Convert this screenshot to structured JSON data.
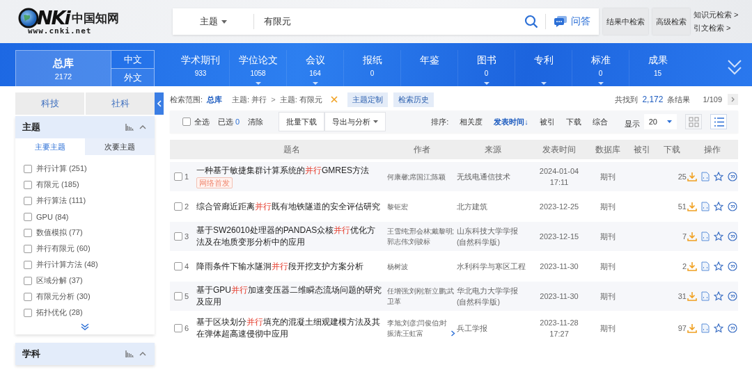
{
  "header": {
    "logo": {
      "letters": "NKi",
      "name": "中国知网",
      "url": "www.cnki.net"
    },
    "search_field": "主题",
    "query": "有限元",
    "qa_label": "问答",
    "buttons": [
      "结果中检索",
      "高级检索"
    ],
    "links": [
      "知识元检索 >",
      "引文检索 >"
    ]
  },
  "nav": {
    "library": {
      "label": "总库",
      "count": "2172",
      "selected": true
    },
    "languages": [
      {
        "label": "中文"
      },
      {
        "label": "外文"
      }
    ],
    "databases": [
      {
        "label": "学术期刊",
        "count": "933",
        "has_menu": false
      },
      {
        "label": "学位论文",
        "count": "1058",
        "has_menu": true
      },
      {
        "label": "会议",
        "count": "164",
        "has_menu": true
      },
      {
        "label": "报纸",
        "count": "0",
        "has_menu": false
      },
      {
        "label": "年鉴",
        "has_menu": false
      },
      {
        "label": "图书",
        "count": "0",
        "has_menu": true
      },
      {
        "label": "专利",
        "has_menu": true
      },
      {
        "label": "标准",
        "count": "0",
        "has_menu": true
      },
      {
        "label": "成果",
        "count": "15",
        "has_menu": false
      }
    ]
  },
  "sidebar": {
    "source_tabs": [
      {
        "label": "科技"
      },
      {
        "label": "社科"
      }
    ],
    "groups": [
      {
        "title": "主题",
        "subtabs": [
          {
            "label": "主要主题",
            "selected": true
          },
          {
            "label": "次要主题",
            "selected": false
          }
        ],
        "items": [
          {
            "label": "并行计算",
            "count": "(251)",
            "checked": false
          },
          {
            "label": "有限元",
            "count": "(185)",
            "checked": false
          },
          {
            "label": "并行算法",
            "count": "(111)",
            "checked": false
          },
          {
            "label": "GPU",
            "count": "(84)",
            "checked": false
          },
          {
            "label": "数值模拟",
            "count": "(77)",
            "checked": false
          },
          {
            "label": "并行有限元",
            "count": "(60)",
            "checked": false
          },
          {
            "label": "并行计算方法",
            "count": "(48)",
            "checked": false
          },
          {
            "label": "区域分解",
            "count": "(37)",
            "checked": false
          },
          {
            "label": "有限元分析",
            "count": "(30)",
            "checked": false
          },
          {
            "label": "拓扑优化",
            "count": "(28)",
            "checked": false
          }
        ]
      },
      {
        "title": "学科"
      }
    ]
  },
  "results": {
    "scope_label": "检索范围:",
    "scope": "总库",
    "crumbs": [
      "主题: 并行",
      "主题: 有限元"
    ],
    "crumb_separator": ">",
    "chips": [
      "主题定制",
      "检索历史"
    ],
    "found_label": "共找到",
    "total": "2,172",
    "total_suffix": "条结果",
    "page": "1/109",
    "select_all": {
      "label": "全选",
      "checked": false
    },
    "selected_label": "已选",
    "selected_count": "0",
    "clear_label": "清除",
    "buttons": [
      "批量下载"
    ],
    "export_label": "导出与分析",
    "sort_label": "排序:",
    "sorts": [
      {
        "label": "相关度",
        "selected": false
      },
      {
        "label": "发表时间↓",
        "selected": true
      },
      {
        "label": "被引",
        "selected": false
      },
      {
        "label": "下载",
        "selected": false
      },
      {
        "label": "综合",
        "selected": false
      }
    ],
    "page_size_label": "显示",
    "page_size": "20",
    "views": [
      {
        "kind": "grid",
        "selected": false
      },
      {
        "kind": "list",
        "selected": true
      }
    ],
    "columns": [
      "题名",
      "作者",
      "来源",
      "发表时间",
      "数据库",
      "被引",
      "下载",
      "操作"
    ],
    "rows": [
      {
        "number": "1",
        "checked": false,
        "title": [
          {
            "text": "一种基于敏捷集群计算系统的",
            "highlight": false
          },
          {
            "text": "并行",
            "highlight": true
          },
          {
            "text": "GMRES方法",
            "highlight": false
          }
        ],
        "badge": "网络首发",
        "authors": "何康馨;席国江;陈颖",
        "more_authors": false,
        "source": "无线电通信技术",
        "date": "2024-01-04",
        "time": "17:11",
        "database": "期刊",
        "downloads": "25"
      },
      {
        "number": "2",
        "checked": false,
        "title": [
          {
            "text": "综合管廊近距离",
            "highlight": false
          },
          {
            "text": "并行",
            "highlight": true
          },
          {
            "text": "既有地铁隧道的安全评估研究",
            "highlight": false
          }
        ],
        "authors": "黎钜宏",
        "more_authors": false,
        "source": "北方建筑",
        "date": "2023-12-25",
        "database": "期刊",
        "downloads": "51"
      },
      {
        "number": "3",
        "checked": false,
        "title": [
          {
            "text": "基于SW26010处理器的PANDAS众核",
            "highlight": false
          },
          {
            "text": "并行",
            "highlight": true
          },
          {
            "text": "优化方法及在地质变形分析中的应用",
            "highlight": false
          }
        ],
        "authors": "王雪纯;邢会林;戴黎明;郭志伟;刘骏标",
        "more_authors": false,
        "source": "山东科技大学学报(自然科学版)",
        "date": "2023-12-15",
        "database": "期刊",
        "downloads": "7"
      },
      {
        "number": "4",
        "checked": false,
        "title": [
          {
            "text": "降雨条件下输水隧洞",
            "highlight": false
          },
          {
            "text": "并行",
            "highlight": true
          },
          {
            "text": "段开挖支护方案分析",
            "highlight": false
          }
        ],
        "authors": "杨树波",
        "more_authors": false,
        "source": "水利科学与寒区工程",
        "date": "2023-11-30",
        "database": "期刊",
        "downloads": "2"
      },
      {
        "number": "5",
        "checked": false,
        "title": [
          {
            "text": "基于GPU",
            "highlight": false
          },
          {
            "text": "并行",
            "highlight": true
          },
          {
            "text": "加速变压器二维瞬态流场问题的研究及应用",
            "highlight": false
          }
        ],
        "authors": "任增强;刘刚;靳立鹏;武卫革",
        "more_authors": false,
        "source": "华北电力大学学报(自然科学版)",
        "date": "2023-11-30",
        "database": "期刊",
        "downloads": "31"
      },
      {
        "number": "6",
        "checked": false,
        "title": [
          {
            "text": "基于区块划分",
            "highlight": false
          },
          {
            "text": "并行",
            "highlight": true
          },
          {
            "text": "填充的混凝土细观建模方法及其在弹体超高速侵彻中应用",
            "highlight": false
          }
        ],
        "authors": "李旭;刘彦;闫俊伯;时振清;王虹富",
        "more_authors": true,
        "source": "兵工学报",
        "date": "2023-11-28",
        "time": "17:27",
        "database": "期刊",
        "downloads": "97"
      }
    ]
  }
}
